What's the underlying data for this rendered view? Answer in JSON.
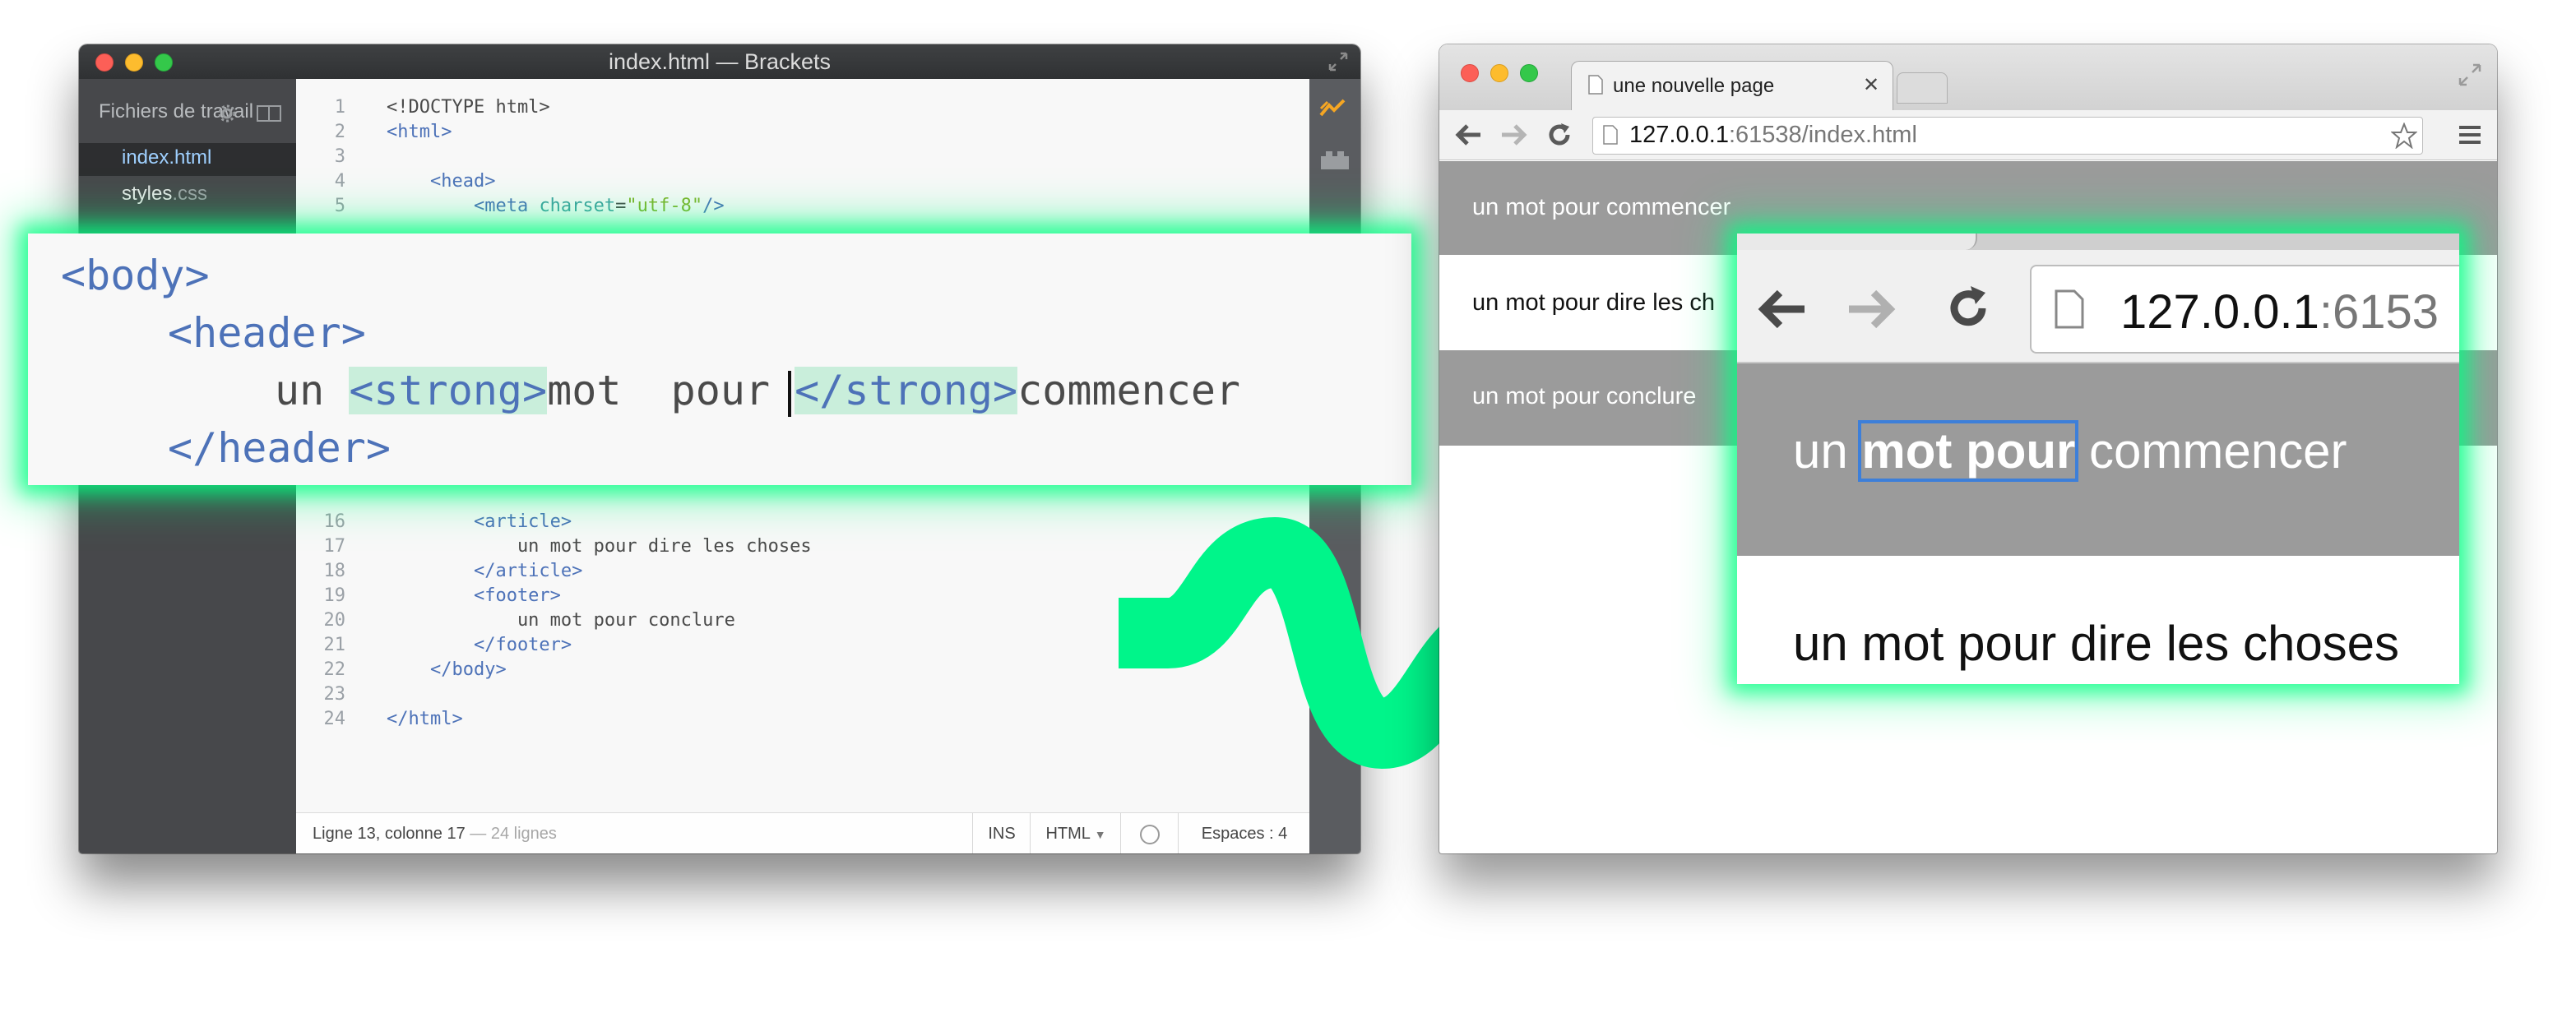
{
  "brackets": {
    "title": "index.html — Brackets",
    "sidebar": {
      "title": "Fichiers de travail",
      "files": [
        {
          "name": "index.html",
          "selected": true
        },
        {
          "name_base": "styles",
          "name_ext": ".css",
          "selected": false
        }
      ]
    },
    "code_lines_top": [
      {
        "num": "1",
        "parts": [
          {
            "t": "<!DOCTYPE html>",
            "c": "txt"
          }
        ]
      },
      {
        "num": "2",
        "parts": [
          {
            "t": "<html>",
            "c": "tag"
          }
        ]
      },
      {
        "num": "3",
        "parts": []
      },
      {
        "num": "4",
        "parts": [
          {
            "t": "    <head>",
            "c": "tag"
          }
        ]
      },
      {
        "num": "5",
        "parts": [
          {
            "t": "        <meta ",
            "c": "tag"
          },
          {
            "t": "charset",
            "c": "attr"
          },
          {
            "t": "=",
            "c": "txt"
          },
          {
            "t": "\"utf-8\"",
            "c": "str"
          },
          {
            "t": "/>",
            "c": "tag"
          }
        ]
      }
    ],
    "code_lines_bottom": [
      {
        "num": "16",
        "parts": [
          {
            "t": "        <article>",
            "c": "tag"
          }
        ]
      },
      {
        "num": "17",
        "parts": [
          {
            "t": "            un mot pour dire les choses",
            "c": "txt"
          }
        ]
      },
      {
        "num": "18",
        "parts": [
          {
            "t": "        </article>",
            "c": "tag"
          }
        ]
      },
      {
        "num": "19",
        "parts": [
          {
            "t": "        <footer>",
            "c": "tag"
          }
        ]
      },
      {
        "num": "20",
        "parts": [
          {
            "t": "            un mot pour conclure",
            "c": "txt"
          }
        ]
      },
      {
        "num": "21",
        "parts": [
          {
            "t": "        </footer>",
            "c": "tag"
          }
        ]
      },
      {
        "num": "22",
        "parts": [
          {
            "t": "    </body>",
            "c": "tag"
          }
        ]
      },
      {
        "num": "23",
        "parts": []
      },
      {
        "num": "24",
        "parts": [
          {
            "t": "</html>",
            "c": "tag"
          }
        ]
      }
    ],
    "status": {
      "position": "Ligne 13, colonne 17",
      "lines": "— 24 lignes",
      "mode": "INS",
      "language": "HTML",
      "spaces": "Espaces : 4"
    },
    "toolbar_icons": [
      "live-preview-icon",
      "extension-manager-icon"
    ]
  },
  "zoom_code": {
    "line1": "<body>",
    "line2": "<header>",
    "line3_a": "un ",
    "line3_tag_open": "<strong>",
    "line3_b": "mot  pour ",
    "line3_tag_close": "</strong>",
    "line3_c": "commencer",
    "line4": "</header>"
  },
  "browser": {
    "tab_title": "une nouvelle page",
    "url_host": "127.0.0.1",
    "url_port": ":61538",
    "url_path": "/index.html",
    "header_text": "un mot pour commencer",
    "article_text_visible": "un mot pour dire les ch",
    "footer_text": "un mot pour conclure"
  },
  "zoom_browser": {
    "url_host": "127.0.0.1",
    "url_port_partial": ":6153",
    "header_a": "un ",
    "header_strong": "mot pour",
    "header_b": " commencer",
    "article_text": "un mot pour dire les choses"
  },
  "colors": {
    "glow": "#00ff88",
    "arrow": "#00f58a",
    "tag_blue": "#4d72b8",
    "header_gray": "#9b9b9b"
  }
}
